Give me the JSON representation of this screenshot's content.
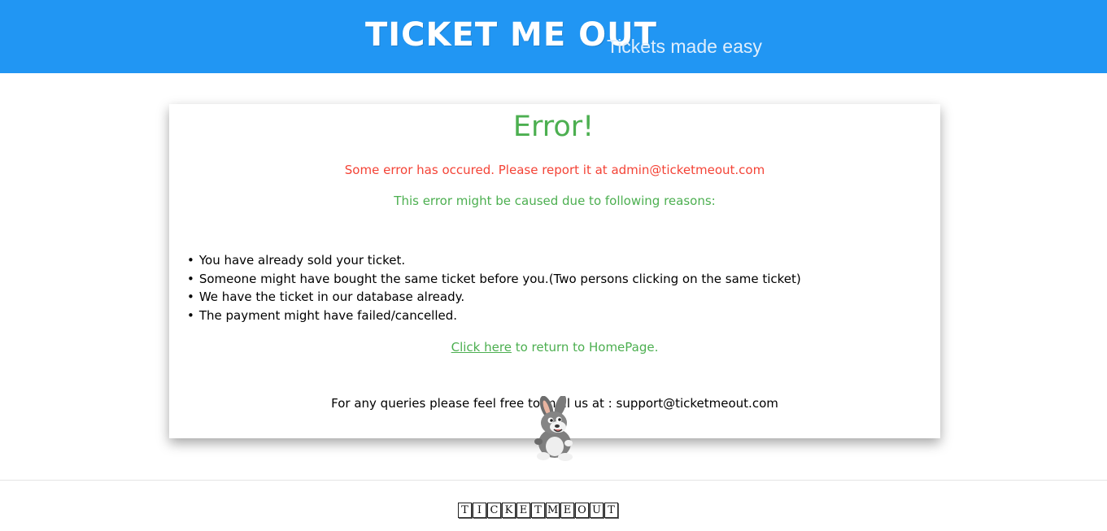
{
  "header": {
    "logo": "TICKET ME OUT",
    "tagline": "Tickets made easy"
  },
  "card": {
    "title": "Error!",
    "error_message": "Some error has occured. Please report it at admin@ticketmeout.com",
    "reasons_intro": "This error might be caused due to following reasons:",
    "reasons": [
      "You have already sold your ticket.",
      "Someone might have bought the same ticket before you.(Two persons clicking on the same ticket)",
      "We have the ticket in our database already.",
      "The payment might have failed/cancelled."
    ],
    "return_link": "Click here",
    "return_suffix": " to return to HomePage.",
    "queries": "For any queries please feel free to mail us at : support@ticketmeout.com"
  },
  "footer": {
    "logo_letters": [
      "T",
      "I",
      "C",
      "K",
      "E",
      "T",
      "M",
      "E",
      "O",
      "U",
      "T"
    ]
  },
  "colors": {
    "header_bg": "#2196f3",
    "title": "#4caf50",
    "error": "#f44336"
  },
  "icons": {
    "mascot": "bunny-mascot-icon"
  }
}
